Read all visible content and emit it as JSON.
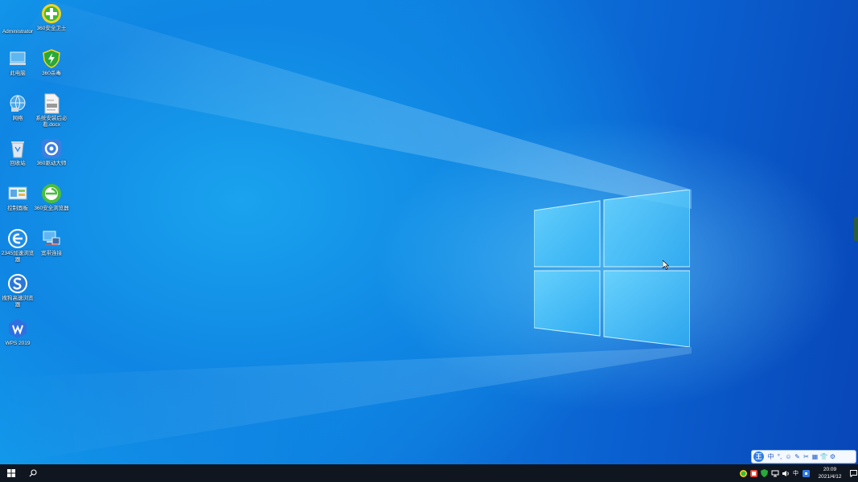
{
  "desktop": {
    "icons": [
      {
        "label": "Administrator",
        "icon": "user-folder-icon"
      },
      {
        "label": "360安全卫士",
        "icon": "360-safe-icon"
      },
      {
        "label": "此电脑",
        "icon": "this-pc-icon"
      },
      {
        "label": "360杀毒",
        "icon": "360-antivirus-icon"
      },
      {
        "label": "网络",
        "icon": "network-icon"
      },
      {
        "label": "系统安装后必看.docx",
        "icon": "docx-icon"
      },
      {
        "label": "回收站",
        "icon": "recycle-bin-icon"
      },
      {
        "label": "360驱动大师",
        "icon": "360-driver-icon"
      },
      {
        "label": "控制面板",
        "icon": "control-panel-icon"
      },
      {
        "label": "360安全浏览器",
        "icon": "360-browser-icon"
      },
      {
        "label": "2345加速浏览器",
        "icon": "2345-browser-icon"
      },
      {
        "label": "宽带连接",
        "icon": "broadband-icon"
      },
      {
        "label": "搜狗高速浏览器",
        "icon": "sogou-browser-icon"
      },
      {
        "label": "WPS 2019",
        "icon": "wps-icon"
      }
    ]
  },
  "ime": {
    "items": [
      "中",
      "°,",
      "☺",
      "✎",
      "✂",
      "▦",
      "👕",
      "⚙"
    ],
    "logo": "王"
  },
  "taskbar": {
    "ime_indicator": "中",
    "time": "20:09",
    "date": "2021/4/12"
  },
  "colors": {
    "taskbar": "#10161f",
    "desktop_primary": "#0e7fe0",
    "accent": "#2f7be6"
  }
}
